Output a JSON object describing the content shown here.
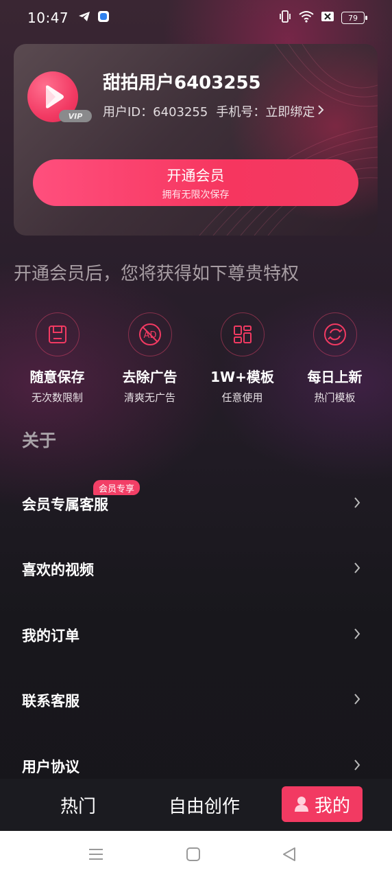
{
  "status_bar": {
    "time": "10:47",
    "battery": "79",
    "icons": [
      "telegram-icon",
      "app-icon",
      "vibrate-icon",
      "wifi-icon",
      "sim-off-icon",
      "battery-icon"
    ]
  },
  "profile": {
    "name": "甜拍用户6403255",
    "id_label": "用户ID：6403255",
    "phone_label": "手机号：立即绑定",
    "vip_badge": "VIP",
    "accent_color": "#f23a62"
  },
  "vip_button": {
    "label": "开通会员",
    "sublabel": "拥有无限次保存"
  },
  "privilege_title": "开通会员后，您将获得如下尊贵特权",
  "features": [
    {
      "icon": "save-icon",
      "title": "随意保存",
      "subtitle": "无次数限制"
    },
    {
      "icon": "ad-block-icon",
      "title": "去除广告",
      "subtitle": "清爽无广告"
    },
    {
      "icon": "template-icon",
      "title": "1W+模板",
      "subtitle": "任意使用"
    },
    {
      "icon": "refresh-icon",
      "title": "每日上新",
      "subtitle": "热门模板"
    }
  ],
  "about_title": "关于",
  "menu": [
    {
      "label": "会员专属客服",
      "tag": "会员专享"
    },
    {
      "label": "喜欢的视频"
    },
    {
      "label": "我的订单"
    },
    {
      "label": "联系客服"
    },
    {
      "label": "用户协议"
    }
  ],
  "bottom_nav": {
    "hot": "热门",
    "create": "自由创作",
    "mine": "我的",
    "active": "mine"
  }
}
